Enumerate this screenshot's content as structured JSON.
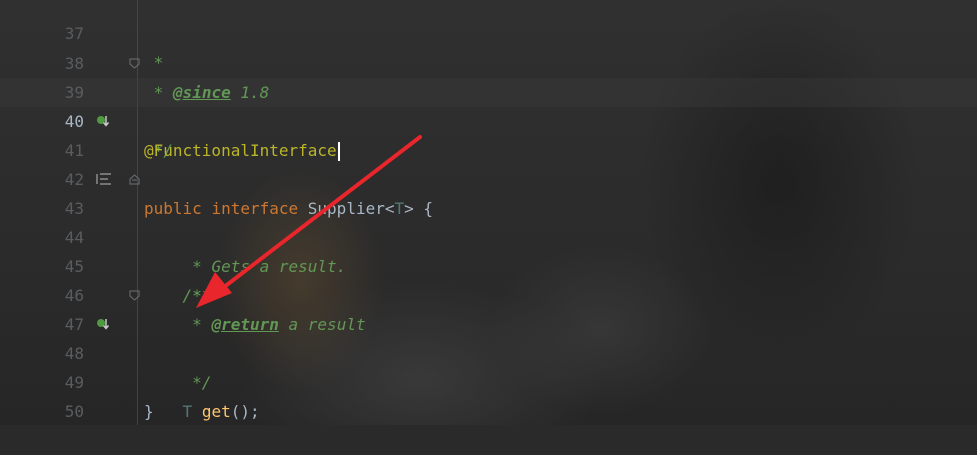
{
  "editor": {
    "lines": [
      {
        "n": "37",
        "text": " *"
      },
      {
        "n": "38",
        "text": " * @since 1.8"
      },
      {
        "n": "39",
        "text": " */"
      },
      {
        "n": "40",
        "text": "@FunctionalInterface"
      },
      {
        "n": "41",
        "text": "public interface Supplier<T> {"
      },
      {
        "n": "42",
        "text": ""
      },
      {
        "n": "43",
        "text": "    /**"
      },
      {
        "n": "44",
        "text": "     * Gets a result."
      },
      {
        "n": "45",
        "text": "     *"
      },
      {
        "n": "46",
        "text": "     * @return a result"
      },
      {
        "n": "47",
        "text": "     */"
      },
      {
        "n": "48",
        "text": "    T get();"
      },
      {
        "n": "49",
        "text": "}"
      },
      {
        "n": "50",
        "text": ""
      }
    ],
    "tokens": {
      "since_tag": "@since",
      "since_value": " 1.8",
      "annotation": "@FunctionalInterface",
      "kw_public": "public",
      "kw_interface": "interface",
      "type_name": "Supplier",
      "lt": "<",
      "type_param": "T",
      "gt_brace": "> {",
      "doc_open": "/**",
      "doc_gets": "* Gets a result.",
      "doc_star": "*",
      "return_tag": "@return",
      "return_text": " a result",
      "doc_close": "*/",
      "ret_type": "T",
      "method_name": "get",
      "method_tail": "();",
      "close_brace": "}"
    },
    "active_line": "40",
    "annotation_arrow_color": "#e8262b"
  }
}
